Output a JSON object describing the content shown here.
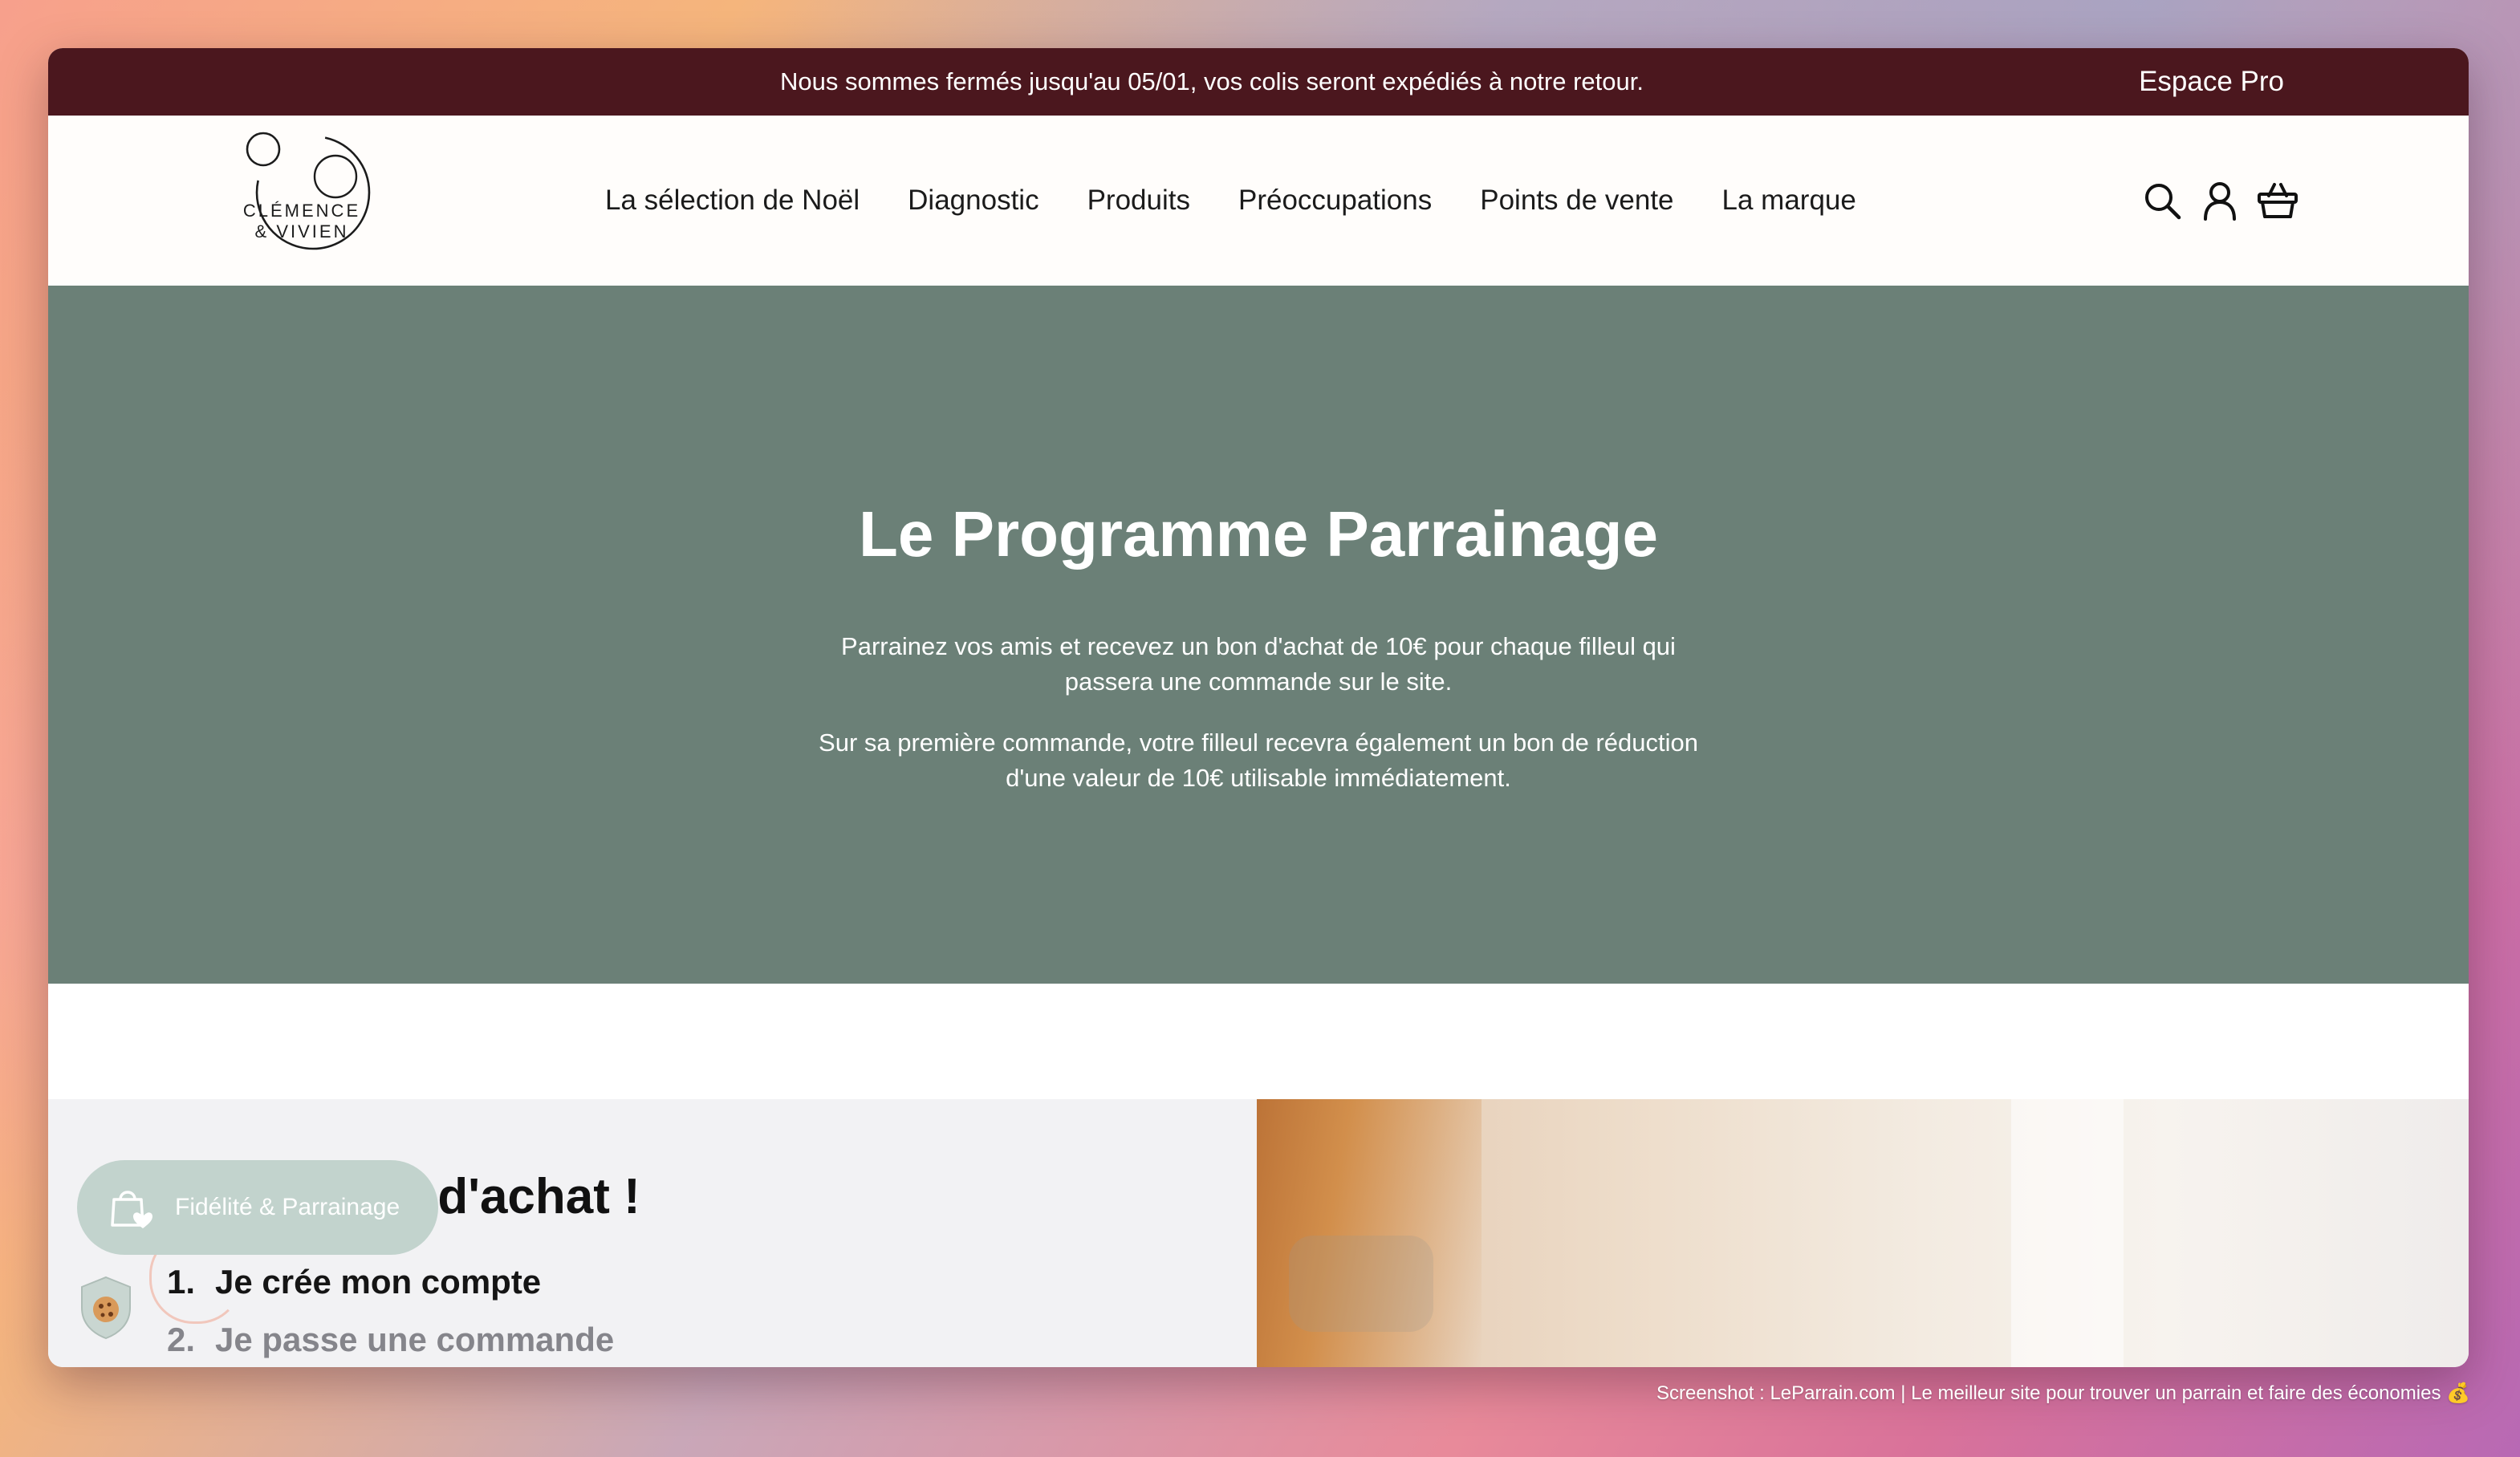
{
  "announcement": {
    "text": "Nous sommes fermés jusqu'au 05/01, vos colis seront expédiés à notre retour.",
    "espace_pro": "Espace Pro"
  },
  "logo": {
    "line1": "CLÉMENCE",
    "line2": "& VIVIEN"
  },
  "nav": {
    "items": [
      "La sélection de Noël",
      "Diagnostic",
      "Produits",
      "Préoccupations",
      "Points de vente",
      "La marque"
    ]
  },
  "header_icons": [
    "search-icon",
    "account-icon",
    "cart-icon"
  ],
  "hero": {
    "title": "Le Programme Parrainage",
    "paragraph1": "Parrainez vos amis et recevez un bon d'achat de 10€ pour chaque filleul qui passera une commande sur le site.",
    "paragraph2": "Sur sa première commande, votre filleul recevra également un bon de réduction d'une valeur de 10€ utilisable immédiatement."
  },
  "steps_section": {
    "heading_visible": "bons d'achat !",
    "steps": [
      {
        "number": "1.",
        "label": "Je crée mon compte"
      },
      {
        "number": "2.",
        "label": "Je passe une commande"
      }
    ]
  },
  "loyalty_button": {
    "label": "Fidélité & Parrainage",
    "icon": "shopping-bag-heart-icon"
  },
  "cookie_button": {
    "icon": "cookie-icon"
  },
  "caption": "Screenshot : LeParrain.com | Le meilleur site pour trouver un parrain et faire des économies 💰",
  "colors": {
    "announcement_bg": "#4b171e",
    "hero_bg": "#6b8077",
    "loyalty_bg": "#c2d3cd",
    "section_bg": "#f2f2f4"
  }
}
